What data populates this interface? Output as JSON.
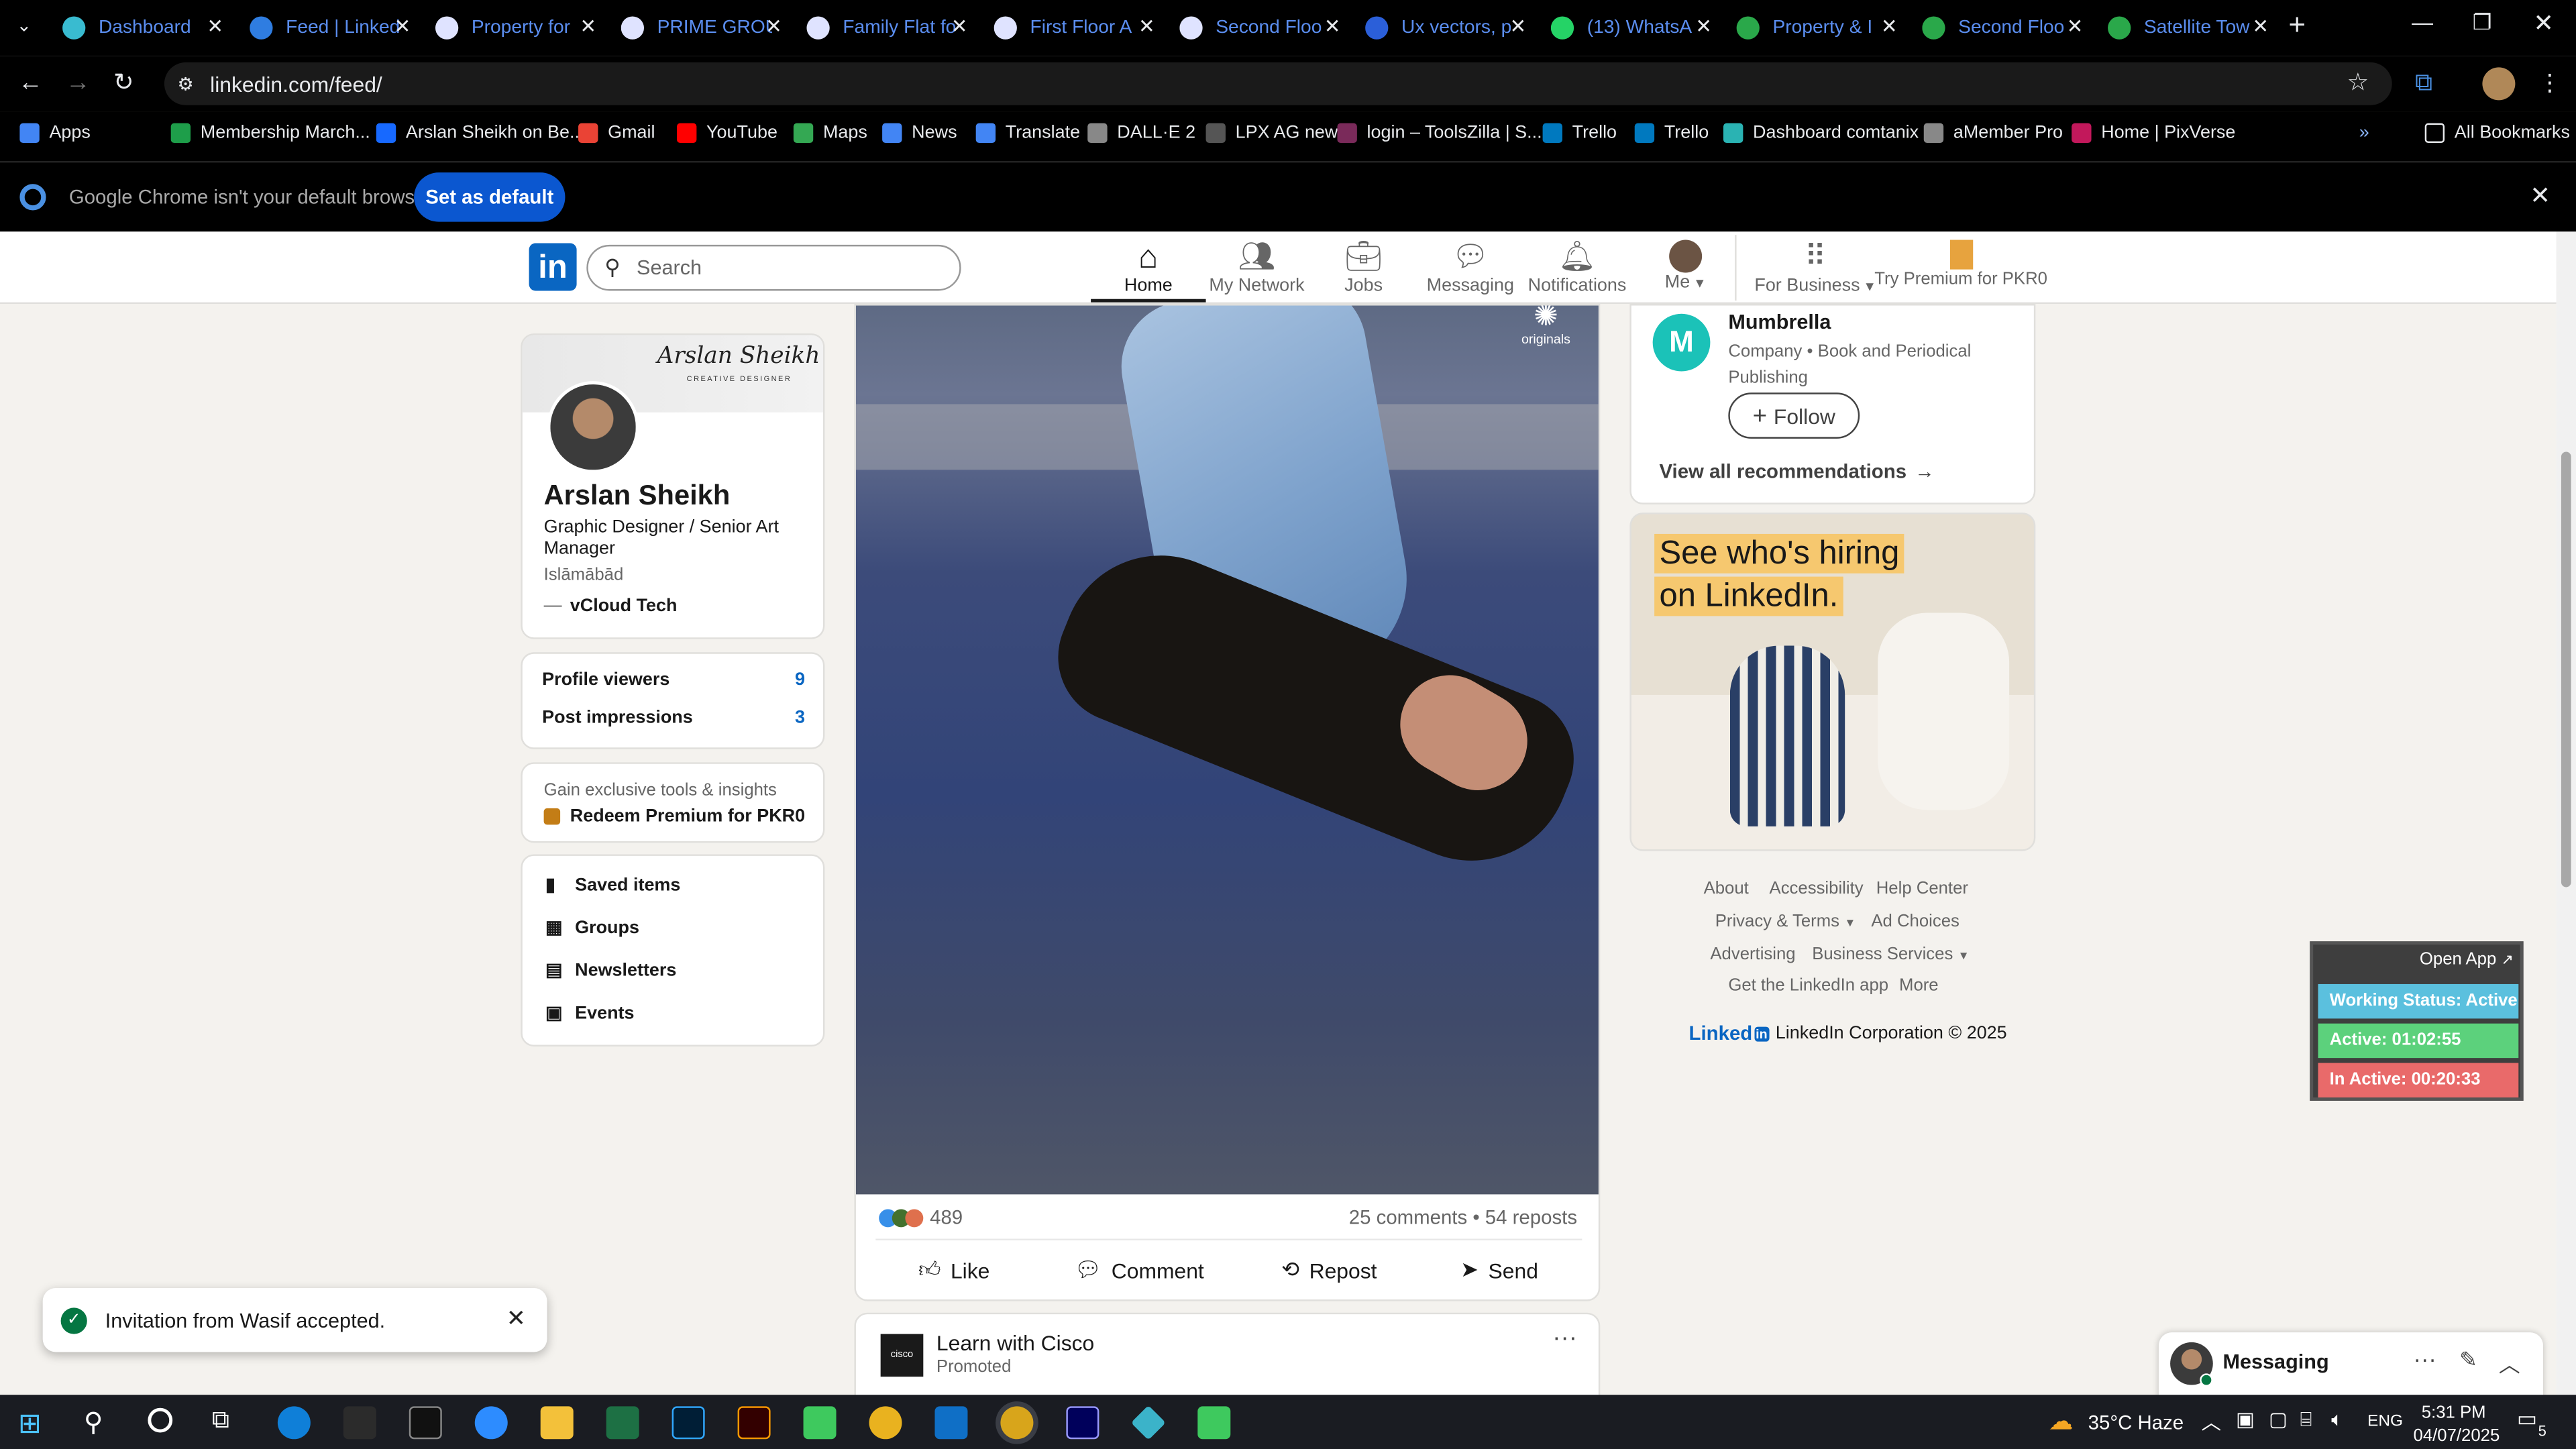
{
  "browser": {
    "tabs": [
      {
        "label": "Dashboard",
        "color": "#39bbd0"
      },
      {
        "label": "Feed | Linked",
        "color": "#2f7de1"
      },
      {
        "label": "Property for",
        "color": "#dfe3ff"
      },
      {
        "label": "PRIME GROU",
        "color": "#dfe3ff"
      },
      {
        "label": "Family Flat fo",
        "color": "#dfe3ff"
      },
      {
        "label": "First Floor A",
        "color": "#dfe3ff"
      },
      {
        "label": "Second Floo",
        "color": "#dfe3ff"
      },
      {
        "label": "Ux vectors, p",
        "color": "#2b5fd9"
      },
      {
        "label": "(13) WhatsA",
        "color": "#25d366"
      },
      {
        "label": "Property & I",
        "color": "#2aa84a"
      },
      {
        "label": "Second Floo",
        "color": "#2aa84a"
      },
      {
        "label": "Satellite Tow",
        "color": "#2aa84a"
      }
    ],
    "url": "linkedin.com/feed/",
    "bookmarks": [
      "Apps",
      "Membership March...",
      "Arslan Sheikh on Be...",
      "Gmail",
      "YouTube",
      "Maps",
      "News",
      "Translate",
      "DALL·E 2",
      "LPX AG new",
      "login – ToolsZilla | S...",
      "Trello",
      "Trello",
      "Dashboard comtanix",
      "aMember Pro",
      "Home | PixVerse"
    ],
    "all_bookmarks": "All Bookmarks",
    "infobar_text": "Google Chrome isn't your default browser",
    "set_default": "Set as default"
  },
  "header": {
    "search_placeholder": "Search",
    "nav": [
      "Home",
      "My Network",
      "Jobs",
      "Messaging",
      "Notifications",
      "Me",
      "For Business",
      "Try Premium for PKR0"
    ]
  },
  "profile": {
    "banner_name": "Arslan Sheikh",
    "banner_sub": "CREATIVE DESIGNER",
    "name": "Arslan Sheikh",
    "headline": "Graphic Designer / Senior Art Manager",
    "location": "Islāmābād",
    "company": "vCloud Tech",
    "stats": [
      {
        "label": "Profile viewers",
        "value": "9"
      },
      {
        "label": "Post impressions",
        "value": "3"
      }
    ],
    "premium_text": "Gain exclusive tools & insights",
    "premium_link": "Redeem Premium for PKR0",
    "links": [
      "Saved items",
      "Groups",
      "Newsletters",
      "Events"
    ]
  },
  "post": {
    "badge": "originals",
    "reactions": "489",
    "comments": "25 comments • 54 reposts",
    "actions": [
      "Like",
      "Comment",
      "Repost",
      "Send"
    ]
  },
  "next_post": {
    "title": "Learn with Cisco",
    "sub": "Promoted"
  },
  "right": {
    "company": "Mumbrella",
    "company_desc": "Company • Book and Periodical Publishing",
    "follow": "Follow",
    "view_all": "View all recommendations",
    "ad_line1": "See who's hiring",
    "ad_line2": "on LinkedIn.",
    "footer": [
      "About",
      "Accessibility",
      "Help Center",
      "Privacy & Terms",
      "Ad Choices",
      "Advertising",
      "Business Services",
      "Get the LinkedIn app",
      "More"
    ],
    "copyright": "LinkedIn Corporation © 2025",
    "brand": "Linked"
  },
  "widget": {
    "open": "Open App",
    "status": "Working Status: Active",
    "active": "Active: 01:02:55",
    "inactive": "In Active: 00:20:33"
  },
  "toast": {
    "text": "Invitation from Wasif accepted."
  },
  "messaging": {
    "label": "Messaging"
  },
  "taskbar": {
    "weather": "35°C  Haze",
    "lang": "ENG",
    "time": "5:31 PM",
    "date": "04/07/2025",
    "notif": "5"
  }
}
